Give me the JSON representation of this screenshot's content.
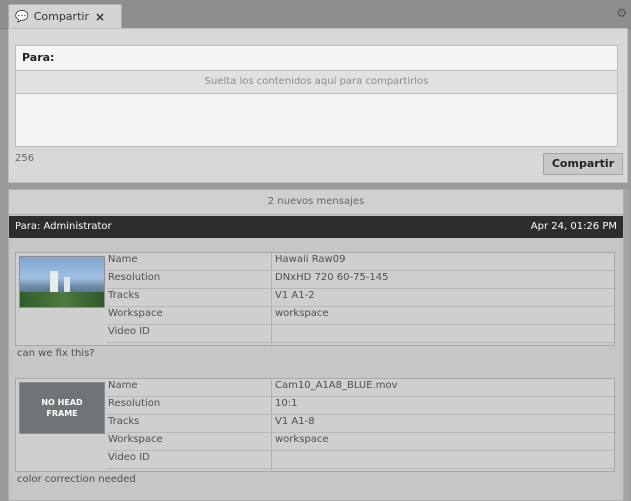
{
  "tab": {
    "title": "Compartir",
    "close": "×",
    "top_right_icon": "⚙"
  },
  "compose": {
    "to_label": "Para:",
    "drop_text": "Suelta los contenidos aquí para compartirlos",
    "char_count": "256",
    "share_button": "Compartir"
  },
  "messages": {
    "new_messages": "2 nuevos mensajes",
    "header": {
      "to": "Para: Administrator",
      "date": "Apr 24, 01:26 PM"
    },
    "items": [
      {
        "name": "Hawaii Raw09",
        "resolution": "DNxHD 720 60-75-145",
        "tracks": "V1 A1-2",
        "workspace": "workspace",
        "video_id": "",
        "comment": "can we fix this?",
        "thumb_type": "image"
      },
      {
        "name": "Cam10_A1A8_BLUE.mov",
        "resolution": "10:1",
        "tracks": "V1 A1-8",
        "workspace": "workspace",
        "video_id": "",
        "comment": "color correction needed",
        "thumb_type": "noframe",
        "thumb_label": "NO HEAD\nFRAME"
      }
    ],
    "labels": {
      "name": "Name",
      "resolution": "Resolution",
      "tracks": "Tracks",
      "workspace": "Workspace",
      "video_id": "Video ID"
    }
  }
}
